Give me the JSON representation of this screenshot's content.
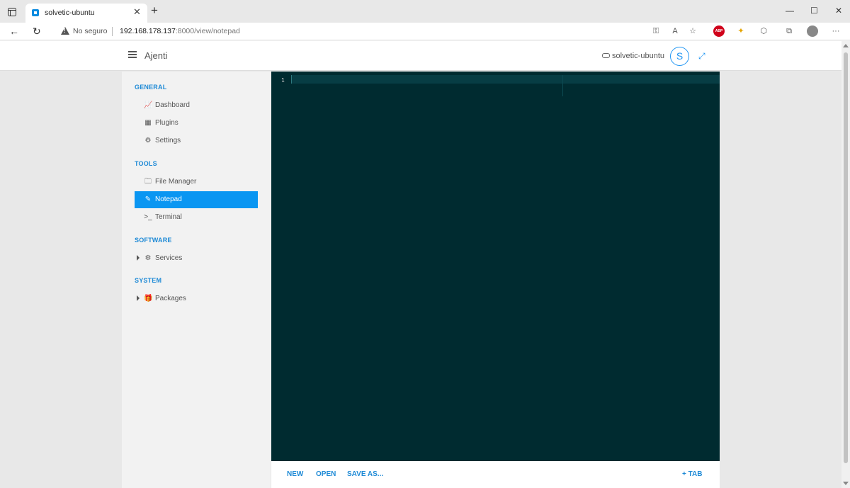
{
  "browser": {
    "tab_title": "solvetic-ubuntu",
    "tab_close": "✕",
    "new_tab": "+",
    "window_controls": [
      "—",
      "☐",
      "✕"
    ],
    "security": "No seguro",
    "url_host": "192.168.178.137",
    "url_rest": ":8000/view/notepad",
    "toolbar_icons": [
      "key-icon",
      "read-aloud-icon",
      "favorites-icon",
      "adblock-icon",
      "extension-icon",
      "puzzle-icon",
      "collections-icon",
      "profile-icon",
      "more-icon"
    ],
    "abp_label": "ABP",
    "more_label": "···"
  },
  "app": {
    "brand": "Ajenti",
    "hostname": "solvetic-ubuntu",
    "avatar_letter": "S",
    "accent_color": "#2196f3"
  },
  "sidebar": {
    "sections": [
      {
        "title": "GENERAL",
        "items": [
          {
            "label": "Dashboard",
            "icon": "chart-icon"
          },
          {
            "label": "Plugins",
            "icon": "grid-icon"
          },
          {
            "label": "Settings",
            "icon": "gear-icon"
          }
        ]
      },
      {
        "title": "TOOLS",
        "items": [
          {
            "label": "File Manager",
            "icon": "folder-icon"
          },
          {
            "label": "Notepad",
            "icon": "pencil-icon",
            "active": true
          },
          {
            "label": "Terminal",
            "icon": "terminal-icon"
          }
        ]
      },
      {
        "title": "SOFTWARE",
        "items": [
          {
            "label": "Services",
            "icon": "cogs-icon",
            "expandable": true
          }
        ]
      },
      {
        "title": "SYSTEM",
        "items": [
          {
            "label": "Packages",
            "icon": "gift-icon",
            "expandable": true
          }
        ]
      }
    ]
  },
  "editor": {
    "line_numbers": [
      "1"
    ],
    "content": ""
  },
  "footer": {
    "new": "NEW",
    "open": "OPEN",
    "save_as": "SAVE AS...",
    "add_tab": "+ TAB"
  }
}
